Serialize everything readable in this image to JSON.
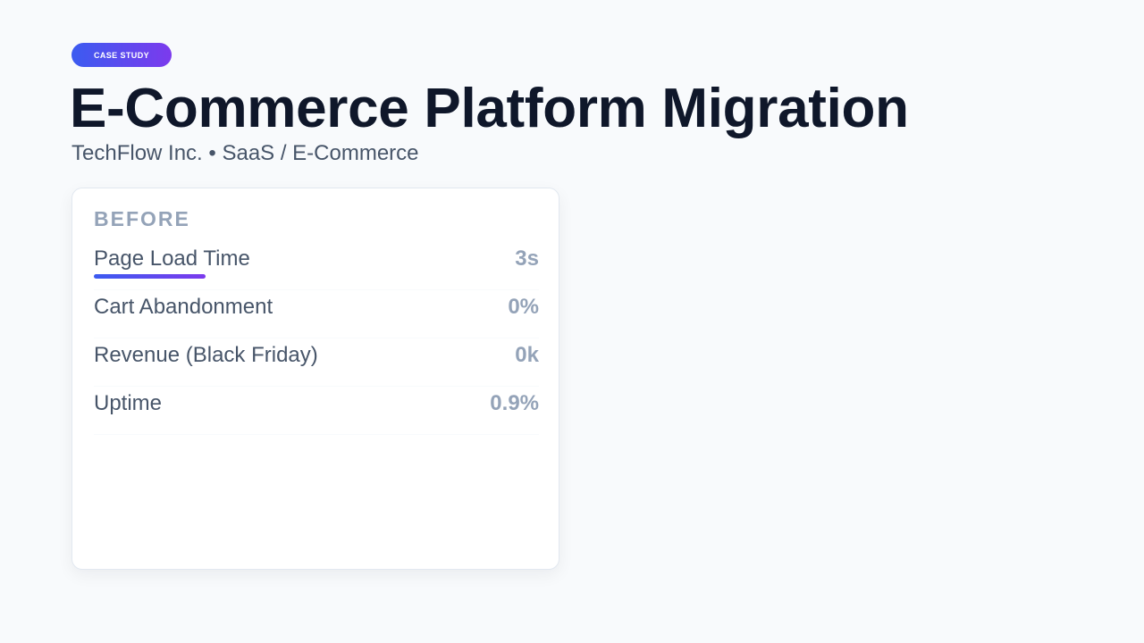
{
  "header": {
    "badge": "CASE STUDY",
    "title": "E-Commerce Platform Migration",
    "subtitle": "TechFlow Inc. • SaaS / E-Commerce"
  },
  "before_card": {
    "heading": "BEFORE",
    "metrics": [
      {
        "label": "Page Load Time",
        "value": "3s"
      },
      {
        "label": "Cart Abandonment",
        "value": "0%"
      },
      {
        "label": "Revenue (Black Friday)",
        "value": "0k"
      },
      {
        "label": "Uptime",
        "value": "0.9%"
      }
    ]
  },
  "colors": {
    "accent_start": "#3b5bf0",
    "accent_end": "#7c3aed",
    "title": "#0f172a",
    "muted": "#94a3b8",
    "text": "#475569",
    "background": "#f8fafc"
  }
}
